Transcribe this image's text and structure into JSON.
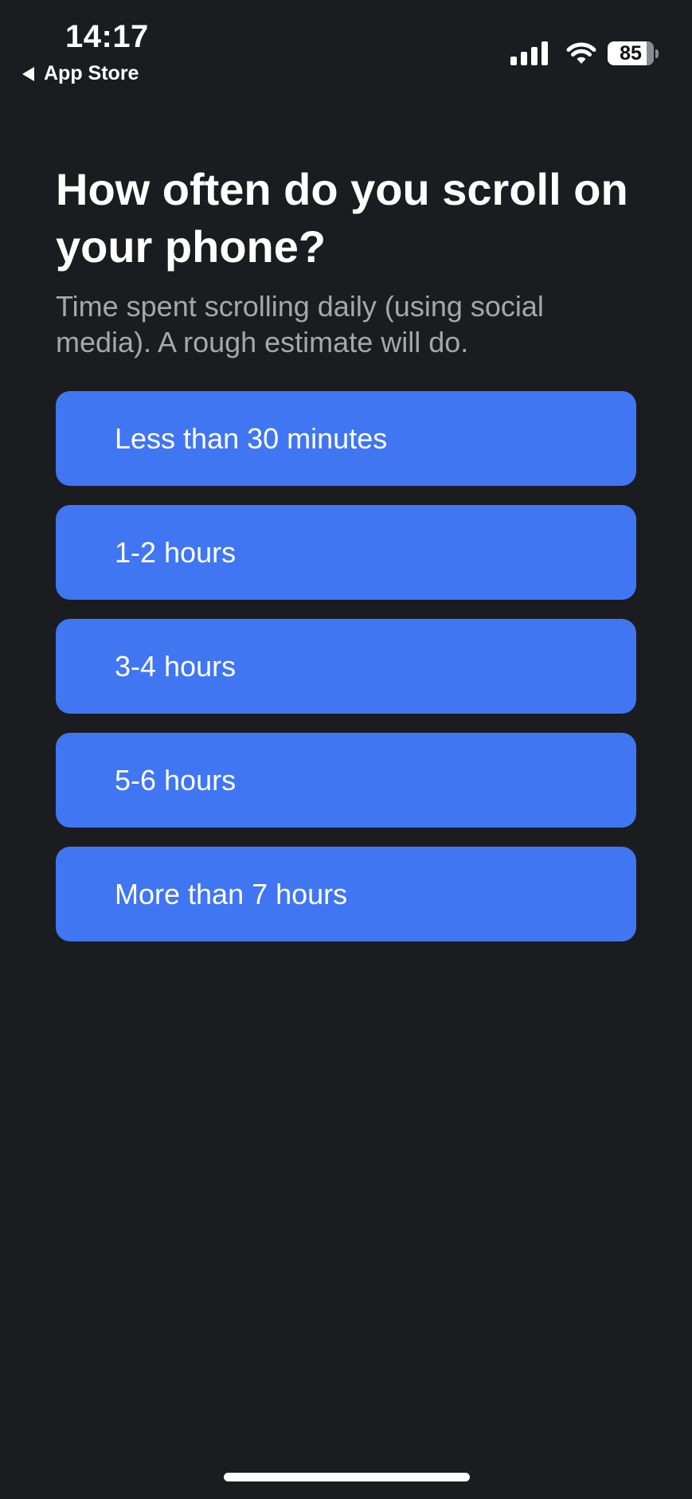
{
  "status_bar": {
    "time": "14:17",
    "back_label": "App Store",
    "battery_level": "85"
  },
  "screen": {
    "question": "How often do you scroll on your phone?",
    "subtitle": "Time spent scrolling daily (using social media). A rough estimate will do.",
    "options": [
      {
        "label": "Less than 30 minutes"
      },
      {
        "label": "1-2 hours"
      },
      {
        "label": "3-4 hours"
      },
      {
        "label": "5-6 hours"
      },
      {
        "label": "More than 7 hours"
      }
    ]
  },
  "colors": {
    "background": "#1b1c20",
    "option_background": "#4076f2",
    "subtitle_text": "#a6a7ad"
  }
}
